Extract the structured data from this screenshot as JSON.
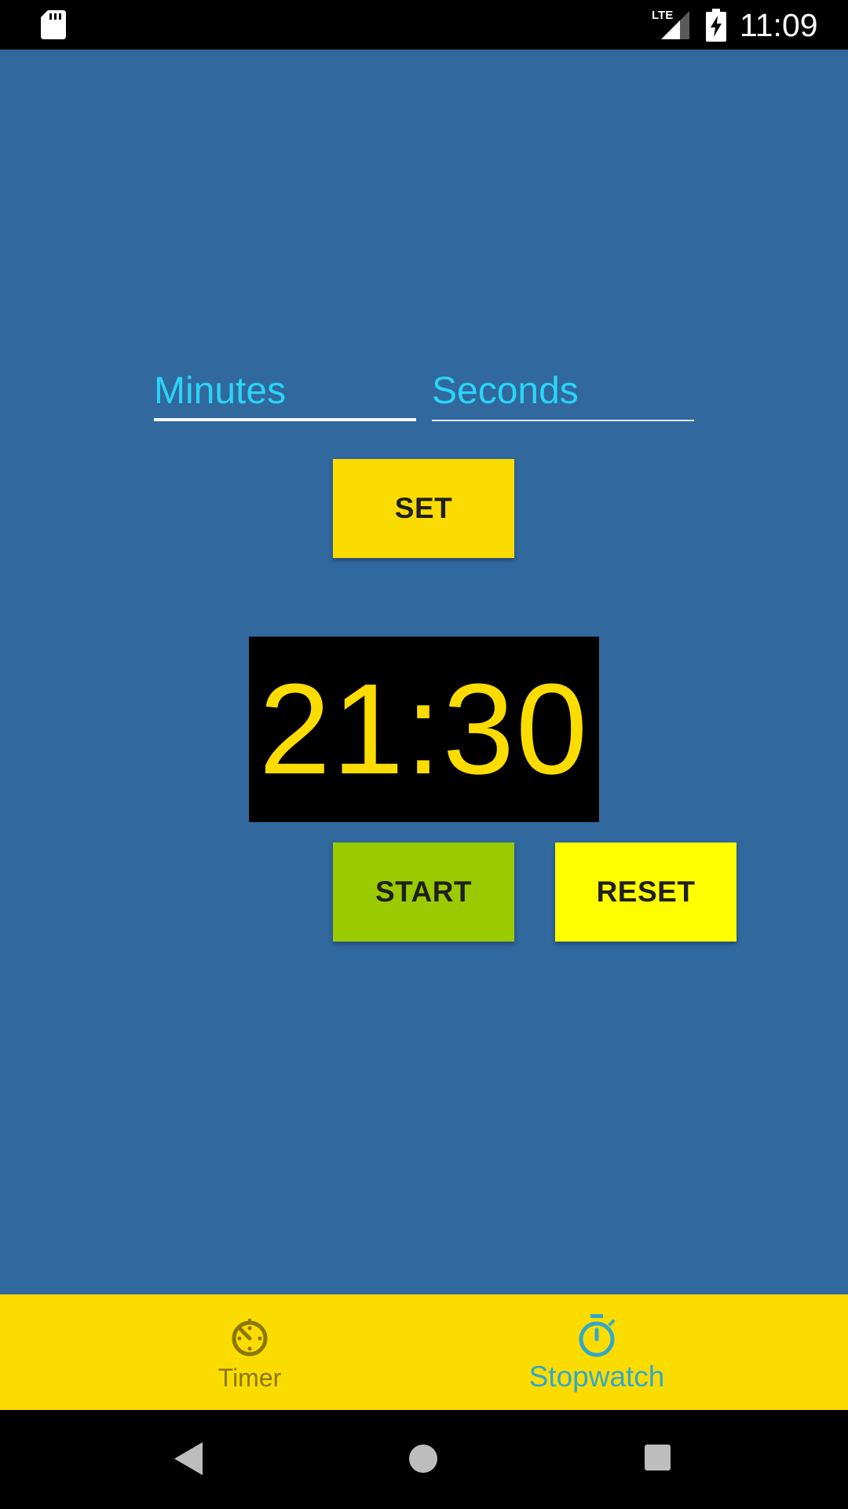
{
  "status_bar": {
    "time": "11:09",
    "network": "LTE",
    "icons": [
      "sd-card-icon",
      "lte-signal-icon",
      "battery-charging-icon"
    ]
  },
  "inputs": {
    "minutes": {
      "placeholder": "Minutes",
      "value": ""
    },
    "seconds": {
      "placeholder": "Seconds",
      "value": ""
    }
  },
  "buttons": {
    "set": "SET",
    "start": "START",
    "reset": "RESET"
  },
  "timer": {
    "display": "21:30"
  },
  "bottom_nav": {
    "items": [
      {
        "label": "Timer",
        "icon": "timer-icon",
        "selected": false
      },
      {
        "label": "Stopwatch",
        "icon": "stopwatch-icon",
        "selected": true
      }
    ]
  },
  "system_nav": {
    "icons": [
      "back-icon",
      "home-icon",
      "recents-icon"
    ]
  },
  "colors": {
    "background": "#31689e",
    "accent_yellow": "#fbdc00",
    "start_green": "#9acb00",
    "reset_yellow": "#ffff00",
    "input_text": "#2ad4f6",
    "nav_selected": "#33a8c8",
    "nav_unselected": "#8a7600"
  }
}
